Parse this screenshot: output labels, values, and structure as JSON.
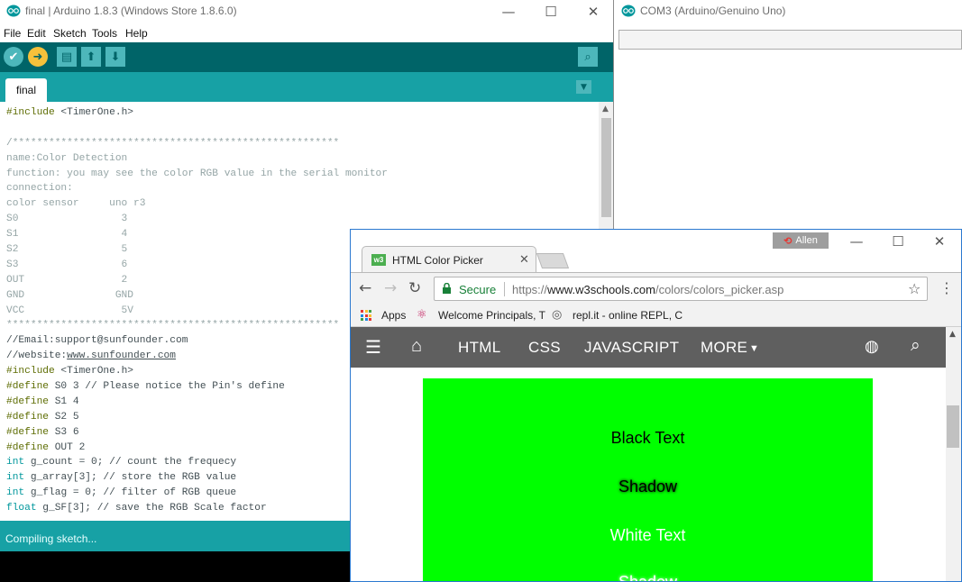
{
  "ide": {
    "title": "final | Arduino 1.8.3 (Windows Store 1.8.6.0)",
    "menu": [
      "File",
      "Edit",
      "Sketch",
      "Tools",
      "Help"
    ],
    "tab": "final",
    "status": "Compiling sketch...",
    "code": [
      [
        [
          "kw",
          "#include"
        ],
        [
          "",
          " <TimerOne.h>"
        ]
      ],
      [
        [
          "",
          ""
        ]
      ],
      [
        [
          "cm",
          "/******************************************************"
        ]
      ],
      [
        [
          "cm",
          "name:Color Detection"
        ]
      ],
      [
        [
          "cm",
          "function: you may see the color RGB value in the serial monitor"
        ]
      ],
      [
        [
          "cm",
          "connection:"
        ]
      ],
      [
        [
          "cm",
          "color sensor     uno r3"
        ]
      ],
      [
        [
          "cm",
          "S0                 3"
        ]
      ],
      [
        [
          "cm",
          "S1                 4"
        ]
      ],
      [
        [
          "cm",
          "S2                 5"
        ]
      ],
      [
        [
          "cm",
          "S3                 6"
        ]
      ],
      [
        [
          "cm",
          "OUT                2"
        ]
      ],
      [
        [
          "cm",
          "GND               GND"
        ]
      ],
      [
        [
          "cm",
          "VCC                5V"
        ]
      ],
      [
        [
          "cm",
          "*******************************************************"
        ]
      ],
      [
        [
          "",
          "//Email:support@sunfounder.com"
        ]
      ],
      [
        [
          "",
          "//website:"
        ],
        [
          "lk",
          "www.sunfounder.com"
        ]
      ],
      [
        [
          "kw",
          "#include"
        ],
        [
          "",
          " <TimerOne.h>"
        ]
      ],
      [
        [
          "kw",
          "#define"
        ],
        [
          "",
          " S0 3 // Please notice the Pin's define"
        ]
      ],
      [
        [
          "kw",
          "#define"
        ],
        [
          "",
          " S1 4"
        ]
      ],
      [
        [
          "kw",
          "#define"
        ],
        [
          "",
          " S2 5"
        ]
      ],
      [
        [
          "kw",
          "#define"
        ],
        [
          "",
          " S3 6"
        ]
      ],
      [
        [
          "kw",
          "#define"
        ],
        [
          "",
          " OUT 2"
        ]
      ],
      [
        [
          "ty",
          "int"
        ],
        [
          "",
          " g_count = 0; // count the frequecy"
        ]
      ],
      [
        [
          "ty",
          "int"
        ],
        [
          "",
          " g_array[3]; // store the RGB value"
        ]
      ],
      [
        [
          "ty",
          "int"
        ],
        [
          "",
          " g_flag = 0; // filter of RGB queue"
        ]
      ],
      [
        [
          "ty",
          "float"
        ],
        [
          "",
          " g_SF[3]; // save the RGB Scale factor"
        ]
      ]
    ]
  },
  "serial": {
    "title": "COM3 (Arduino/Genuino Uno)"
  },
  "chrome": {
    "profile": "Allen",
    "tab_title": "HTML Color Picker",
    "tab_favicon": "w3",
    "secure_label": "Secure",
    "url_scheme": "https://",
    "url_host": "www.w3schools.com",
    "url_path": "/colors/colors_picker.asp",
    "bookmarks": [
      "Apps",
      "Welcome Principals, T",
      "repl.it - online REPL, C"
    ],
    "nav": [
      "HTML",
      "CSS",
      "JAVASCRIPT",
      "MORE"
    ],
    "swatch_color": "#00ff00",
    "swatch_lines": [
      "Black Text",
      "Shadow",
      "White Text",
      "Shadow"
    ]
  }
}
